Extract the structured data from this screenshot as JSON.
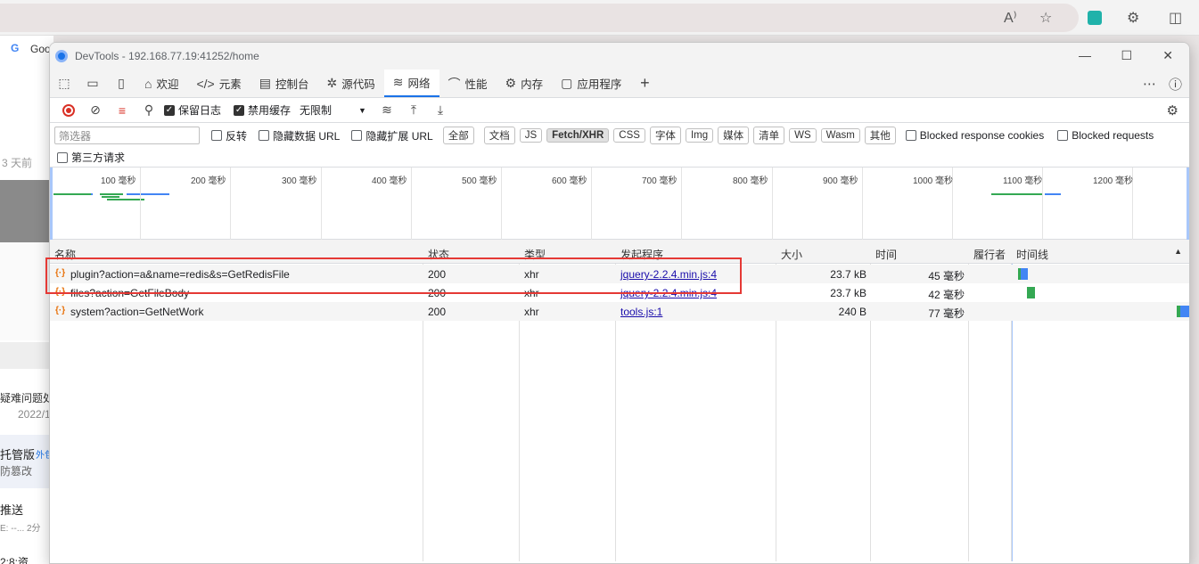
{
  "browser": {
    "title_icons": [
      "read-aloud-icon",
      "favorite-star-icon",
      "extension-icon",
      "puzzle-icon",
      "split-screen-icon"
    ],
    "tab_label": "Goo",
    "read_aloud": "A⁾"
  },
  "bg_page": {
    "time_ago": "3 天前",
    "snippet1": "疑难问题处",
    "date": "2022/1",
    "hosting": "托管版",
    "hosting_badge": "外包",
    "tamper": "防篡改",
    "push": "推送",
    "push_sub": "E: --...  2分",
    "bottom": "2:8:资"
  },
  "window": {
    "title": "DevTools - 192.168.77.19:41252/home"
  },
  "tabs": [
    {
      "label": "欢迎",
      "icon": "home-icon"
    },
    {
      "label": "元素",
      "icon": "code-icon"
    },
    {
      "label": "控制台",
      "icon": "console-icon"
    },
    {
      "label": "源代码",
      "icon": "bug-icon"
    },
    {
      "label": "网络",
      "icon": "wifi-icon"
    },
    {
      "label": "性能",
      "icon": "performance-icon"
    },
    {
      "label": "内存",
      "icon": "memory-icon"
    },
    {
      "label": "应用程序",
      "icon": "application-icon"
    }
  ],
  "toolbar": {
    "preserve_log": "保留日志",
    "disable_cache": "禁用缓存",
    "throttle": "无限制"
  },
  "filter": {
    "placeholder": "筛选器",
    "invert": "反转",
    "hide_data_urls": "隐藏数据 URL",
    "hide_ext_urls": "隐藏扩展 URL",
    "chips": [
      "全部",
      "文档",
      "JS",
      "Fetch/XHR",
      "CSS",
      "字体",
      "Img",
      "媒体",
      "清单",
      "WS",
      "Wasm",
      "其他"
    ],
    "active_chip": "Fetch/XHR",
    "blocked_cookies": "Blocked response cookies",
    "blocked_requests": "Blocked requests",
    "third_party": "第三方请求"
  },
  "overview": {
    "ticks": [
      "100 毫秒",
      "200 毫秒",
      "300 毫秒",
      "400 毫秒",
      "500 毫秒",
      "600 毫秒",
      "700 毫秒",
      "800 毫秒",
      "900 毫秒",
      "1000 毫秒",
      "1100 毫秒",
      "1200 毫秒"
    ]
  },
  "table": {
    "headers": {
      "name": "名称",
      "status": "状态",
      "type": "类型",
      "initiator": "发起程序",
      "size": "大小",
      "time": "时间",
      "fulfilled": "履行者",
      "waterfall": "时间线"
    },
    "rows": [
      {
        "name": "plugin?action=a&name=redis&s=GetRedisFile",
        "status": "200",
        "type": "xhr",
        "initiator": "jquery-2.2.4.min.js:4",
        "size": "23.7 kB",
        "time": "45 毫秒"
      },
      {
        "name": "files?action=GetFileBody",
        "status": "200",
        "type": "xhr",
        "initiator": "jquery-2.2.4.min.js:4",
        "size": "23.7 kB",
        "time": "42 毫秒"
      },
      {
        "name": "system?action=GetNetWork",
        "status": "200",
        "type": "xhr",
        "initiator": "tools.js:1",
        "size": "240 B",
        "time": "77 毫秒"
      }
    ]
  },
  "colors": {
    "accent": "#1a73e8",
    "highlight": "#e53935",
    "waiting_green": "#34a853",
    "download_blue": "#4285f4"
  }
}
